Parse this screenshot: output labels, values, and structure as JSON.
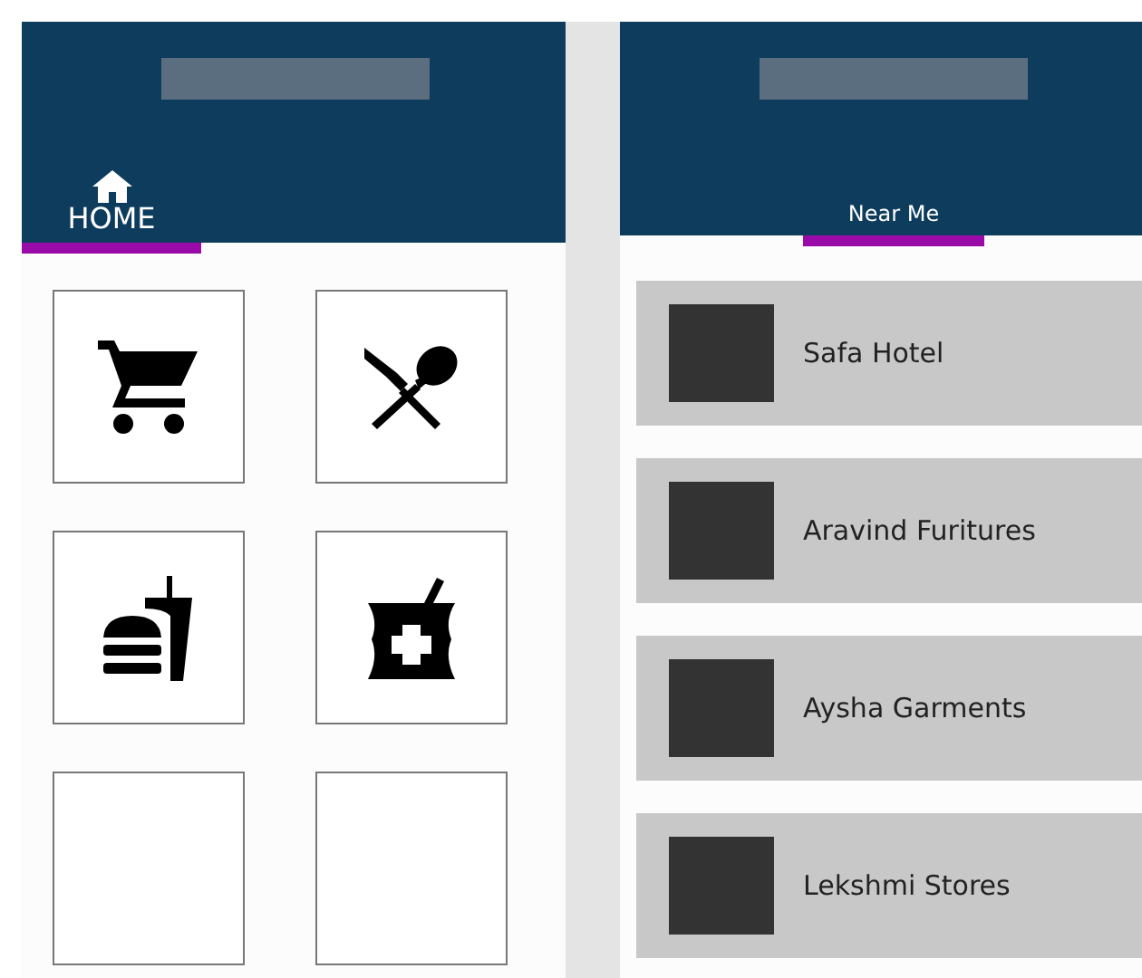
{
  "home_screen": {
    "tabs": [
      {
        "label": "HOME",
        "kind": "home",
        "selected": true
      }
    ],
    "tiles": [
      {
        "kind": "cart"
      },
      {
        "kind": "dining"
      },
      {
        "kind": "fastfood"
      },
      {
        "kind": "pharmacy"
      },
      {
        "kind": "empty"
      },
      {
        "kind": "empty"
      }
    ]
  },
  "near_me_screen": {
    "tabs": [
      {
        "label": "Near Me",
        "selected": true
      }
    ],
    "places": [
      {
        "name": "Safa Hotel"
      },
      {
        "name": "Aravind Furitures"
      },
      {
        "name": "Aysha Garments"
      },
      {
        "name": "Lekshmi Stores"
      }
    ]
  }
}
